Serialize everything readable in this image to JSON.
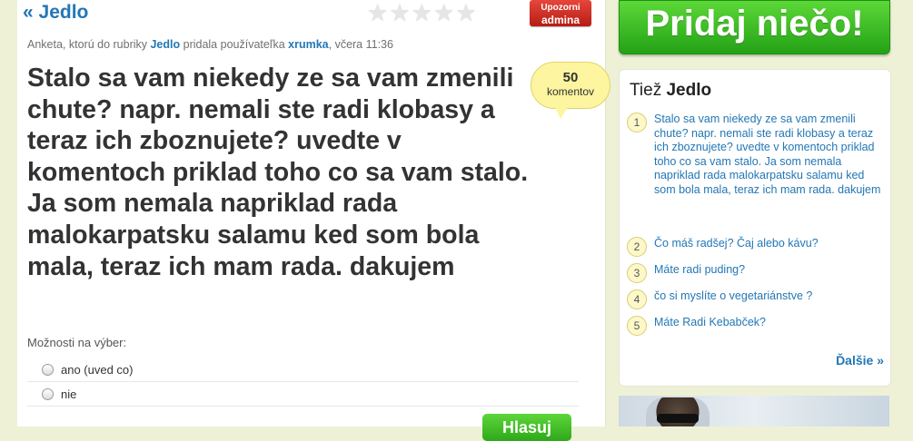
{
  "header": {
    "back_link": "« Jedlo",
    "rating_stars": 5,
    "report": {
      "line1": "Upozorni",
      "line2": "admina"
    }
  },
  "meta": {
    "prefix": "Anketa, ktorú do rubriky ",
    "category": "Jedlo",
    "middle": " pridala používateľka ",
    "user": "xrumka",
    "time": ", včera 11:36"
  },
  "question": "Stalo sa vam niekedy ze sa vam zmenili chute? napr. nemali ste radi klobasy a teraz ich zboznujete? uvedte v komentoch priklad toho co sa vam stalo. Ja som nemala napriklad rada malokarpatsku salamu ked som bola mala, teraz ich mam rada. dakujem",
  "comments": {
    "count": "50",
    "label": "komentov"
  },
  "poll": {
    "options_label": "Možnosti na výber:",
    "options": [
      "ano (uved co)",
      "nie"
    ],
    "vote_label": "Hlasuj"
  },
  "sidebar": {
    "add_button": "Pridaj niečo!",
    "title_prefix": "Tiež ",
    "title_category": "Jedlo",
    "items": [
      {
        "num": "1",
        "text": "Stalo sa vam niekedy ze sa vam zmenili chute? napr. nemali ste radi klobasy a teraz ich zboznujete? uvedte v komentoch priklad toho co sa vam stalo. Ja som nemala napriklad rada malokarpatsku salamu ked som bola mala, teraz ich mam rada. dakujem"
      },
      {
        "num": "2",
        "text": "Čo máš radšej? Čaj alebo kávu?"
      },
      {
        "num": "3",
        "text": "Máte radi puding?"
      },
      {
        "num": "4",
        "text": "čo si myslíte o vegetariánstve ?"
      },
      {
        "num": "5",
        "text": "Máte Radi Kebabček?"
      }
    ],
    "more": "Ďalšie »"
  },
  "colors": {
    "link": "#2277b5",
    "green": "#2ea81a",
    "red": "#d0281f",
    "bubble": "#fdf59f"
  }
}
